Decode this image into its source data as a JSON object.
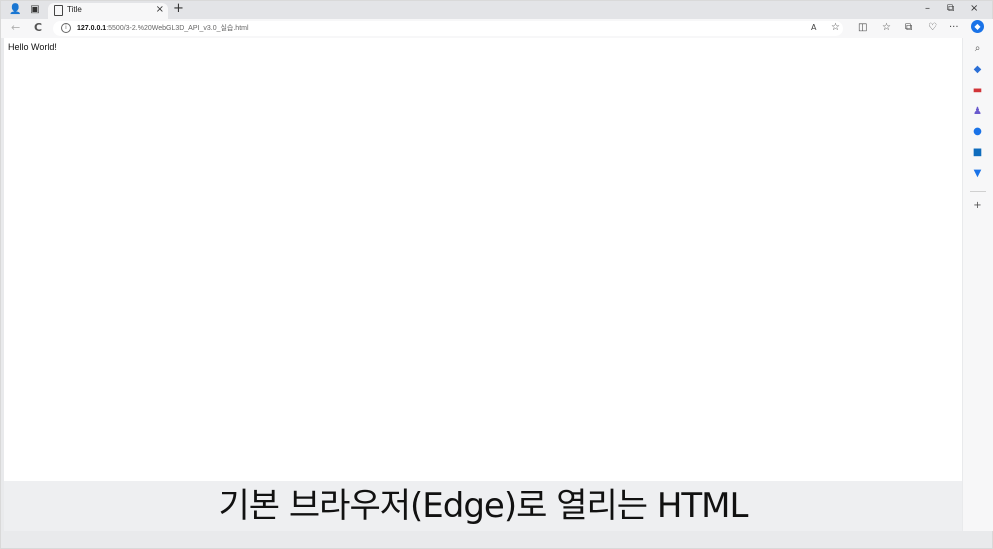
{
  "tab": {
    "title": "Title",
    "close": "×"
  },
  "tabbar": {
    "new_tab": "+",
    "minimize": "–",
    "restore": "⧉",
    "close": "×"
  },
  "nav": {
    "back": "←",
    "reload": "C",
    "url_host": "127.0.0.1",
    "url_rest": ":5500/3-2.%20WebGL3D_API_v3.0_실습.html",
    "more": "···"
  },
  "page": {
    "text": "Hello World!"
  },
  "caption": {
    "text": "기본 브라우저(Edge)로 열리는 HTML"
  },
  "sidebar": {
    "add": "+"
  },
  "colors": {
    "sidebar_blue": "#1a73e8",
    "sidebar_red": "#d13438",
    "sidebar_teal": "#0f6cbd"
  }
}
